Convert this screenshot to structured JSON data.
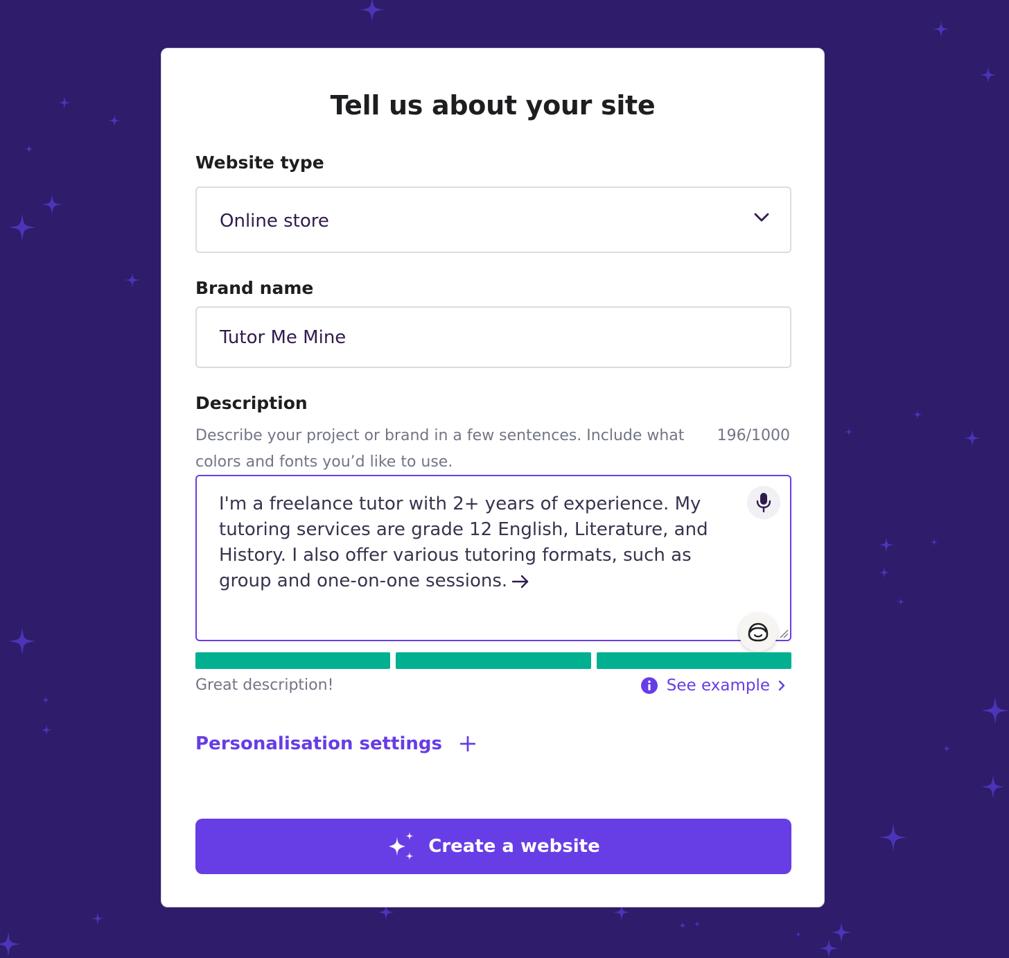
{
  "page": {
    "title": "Tell us about your site"
  },
  "form": {
    "website_type": {
      "label": "Website type",
      "value": "Online store"
    },
    "brand_name": {
      "label": "Brand name",
      "value": "Tutor Me Mine"
    },
    "description": {
      "label": "Description",
      "hint": "Describe your project or brand in a few sentences. Include what colors and fonts you’d like to use.",
      "counter": "196/1000",
      "value": "I'm a freelance tutor with 2+ years of experience. My tutoring services are grade 12 English, Literature, and History. I also offer various tutoring formats, such as group and one-on-one sessions.",
      "quality_segments_filled": 3,
      "quality_segments_total": 3,
      "status": "Great description!",
      "see_example": "See example"
    },
    "personalisation": {
      "label": "Personalisation settings"
    },
    "submit": {
      "label": "Create a website"
    }
  },
  "colors": {
    "background": "#2f1c6a",
    "accent": "#673de6",
    "success": "#00b090",
    "text": "#1d1e20",
    "muted": "#727586"
  },
  "icons": [
    "sparkle-icon",
    "chevron-down-icon",
    "microphone-icon",
    "arrow-right-icon",
    "assistant-face-icon",
    "info-icon",
    "chevron-right-icon",
    "plus-icon",
    "ai-sparkles-icon"
  ]
}
